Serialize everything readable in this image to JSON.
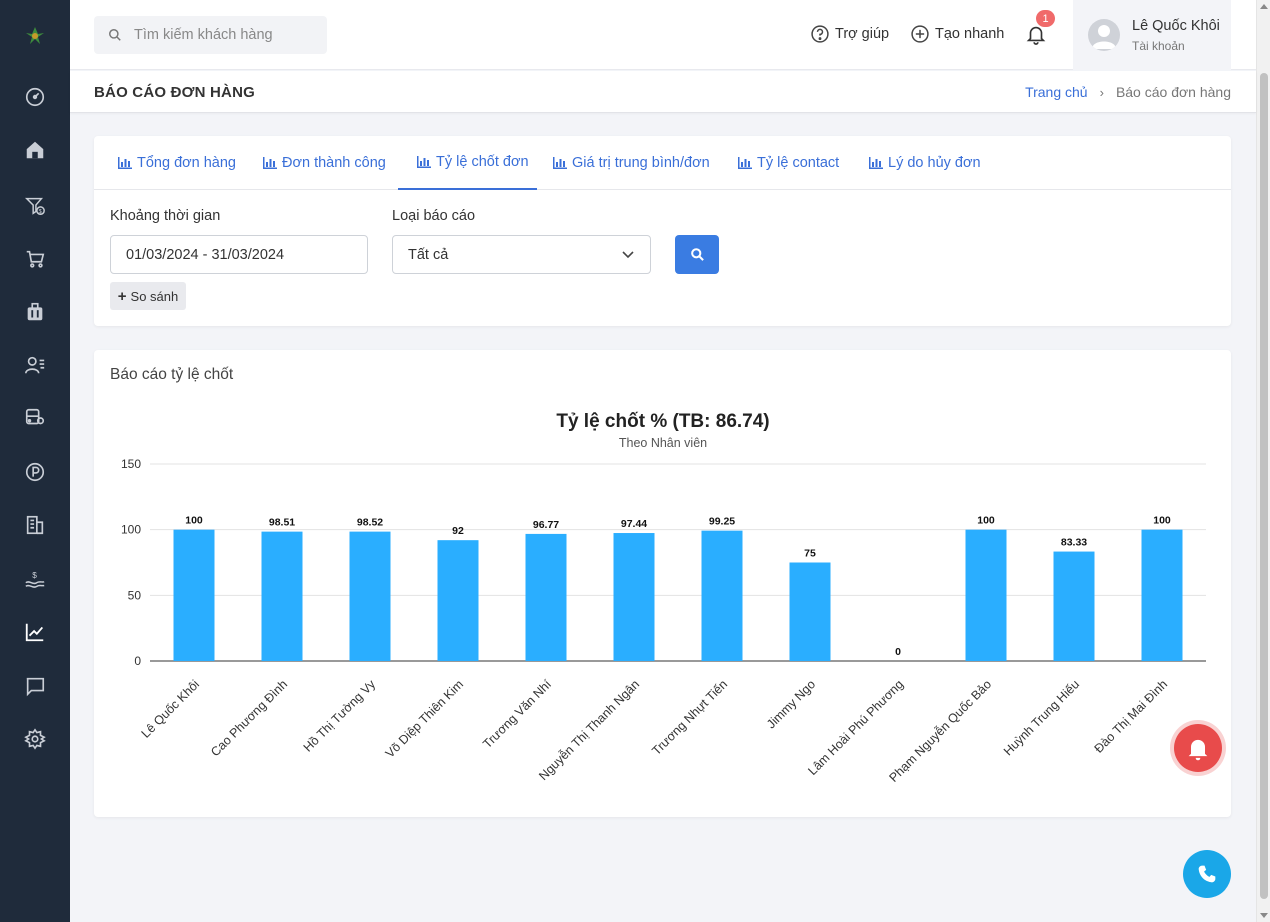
{
  "header": {
    "search_placeholder": "Tìm kiếm khách hàng",
    "help_label": "Trợ giúp",
    "quick_create_label": "Tạo nhanh",
    "notification_count": "1",
    "user_name": "Lê Quốc Khôi",
    "user_role": "Tài khoản"
  },
  "sidebar": {
    "icons": [
      "logo-icon",
      "dashboard-icon",
      "home-icon",
      "funnel-money-icon",
      "cart-icon",
      "briefcase-icon",
      "contacts-icon",
      "bus-location-icon",
      "parking-icon",
      "building-icon",
      "money-icon",
      "chart-line-icon",
      "chat-icon",
      "settings-icon"
    ]
  },
  "page": {
    "title": "BÁO CÁO ĐƠN HÀNG",
    "breadcrumb_home": "Trang chủ",
    "breadcrumb_current": "Báo cáo đơn hàng"
  },
  "tabs": [
    {
      "label": "Tổng đơn hàng"
    },
    {
      "label": "Đơn thành công"
    },
    {
      "label": "Tỷ lệ chốt đơn"
    },
    {
      "label": "Giá trị trung bình/đơn"
    },
    {
      "label": "Tỷ lệ contact"
    },
    {
      "label": "Lý do hủy đơn"
    }
  ],
  "filters": {
    "date_label": "Khoảng thời gian",
    "date_value": "01/03/2024 - 31/03/2024",
    "type_label": "Loại báo cáo",
    "type_value": "Tất cả",
    "compare_label": "So sánh"
  },
  "report": {
    "card_title": "Báo cáo tỷ lệ chốt"
  },
  "colors": {
    "accent": "#3a6fd8",
    "bar": "#2aaeff",
    "sidebar": "#1f2b3b",
    "alert": "#e84b4b",
    "phone": "#1aa7e8"
  },
  "chart_data": {
    "type": "bar",
    "title": "Tỷ lệ chốt % (TB: 86.74)",
    "subtitle": "Theo Nhân viên",
    "xlabel": "",
    "ylabel": "",
    "ylim": [
      0,
      150
    ],
    "yticks": [
      0,
      50,
      100,
      150
    ],
    "grid": true,
    "categories": [
      "Lê Quốc Khôi",
      "Cao Phương Đình",
      "Hồ Thị Tường Vy",
      "Võ Diệp Thiên Kim",
      "Trương Văn Nhí",
      "Nguyễn Thị Thanh Ngân",
      "Trương Nhựt Tiến",
      "Jimmy Ngo",
      "Lâm Hoài Phú Phương",
      "Phạm Nguyễn Quốc Bảo",
      "Huỳnh Trung Hiếu",
      "Đào Thị Mai Đình"
    ],
    "values": [
      100,
      98.51,
      98.52,
      92,
      96.77,
      97.44,
      99.25,
      75,
      0,
      100,
      83.33,
      100
    ]
  }
}
